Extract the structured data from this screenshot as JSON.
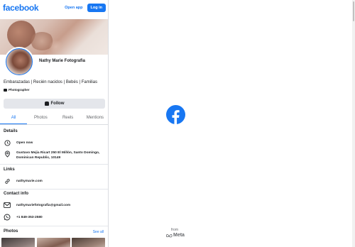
{
  "header": {
    "logo": "facebook",
    "open_app": "Open app",
    "login": "Log in"
  },
  "profile": {
    "name": "Nathy Marie Fotografia",
    "bio": "Embarazadas | Recién nacidos | Bebés | Familias",
    "category": "Photographer",
    "follow": "Follow"
  },
  "tabs": [
    "All",
    "Photos",
    "Reels",
    "Mentions"
  ],
  "details": {
    "title": "Details",
    "status": "Open now",
    "address": "Gustavo Mejia Ricart 250 El Millón, Santo Domingo, Dominican Republic, 10149"
  },
  "links": {
    "title": "Links",
    "website": "nathymarie.com"
  },
  "contact": {
    "title": "Contact info",
    "email": "nathymariefotografia@gmail.com",
    "phone": "+1 849-353-2580"
  },
  "photos": {
    "title": "Photos",
    "see_all": "See all"
  },
  "footer": {
    "from": "from",
    "meta": "Meta"
  },
  "colors": {
    "brand": "#1877f2",
    "text": "#1c1e21",
    "muted": "#65676b"
  }
}
